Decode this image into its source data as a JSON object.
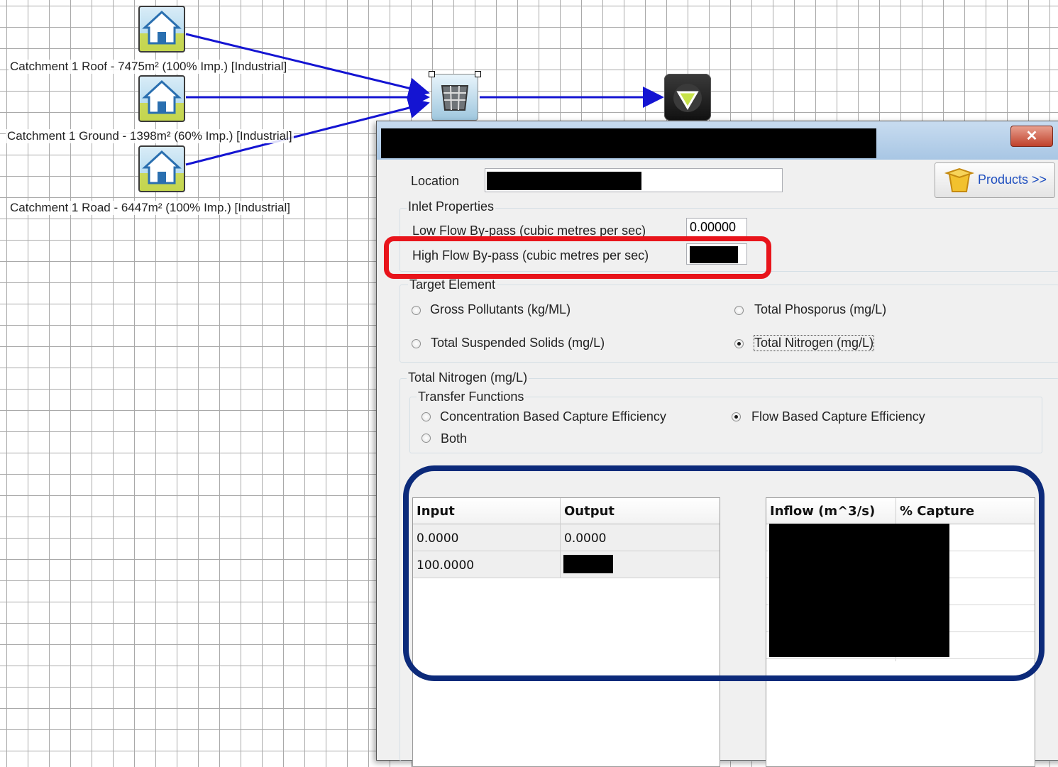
{
  "canvas": {
    "nodes": [
      {
        "label": "Catchment 1 Roof - 7475m² (100% Imp.) [Industrial]"
      },
      {
        "label": "Catchment 1 Ground - 1398m² (60% Imp.) [Industrial]"
      },
      {
        "label": "Catchment 1 Road - 6447m² (100% Imp.) [Industrial]"
      }
    ]
  },
  "dialog": {
    "close_glyph": "✕",
    "location_label": "Location",
    "products_label": "Products >>",
    "inlet": {
      "legend": "Inlet Properties",
      "low_flow_label": "Low Flow By-pass (cubic metres per sec)",
      "low_flow_value": "0.00000",
      "high_flow_label": "High Flow By-pass (cubic metres per sec)"
    },
    "target": {
      "legend": "Target Element",
      "options": [
        "Gross Pollutants (kg/ML)",
        "Total Phosporus (mg/L)",
        "Total Suspended Solids (mg/L)",
        "Total Nitrogen (mg/L)"
      ],
      "selected": "Total Nitrogen (mg/L)"
    },
    "nitrogen": {
      "legend": "Total Nitrogen (mg/L)",
      "transfer_legend": "Transfer Functions",
      "options": [
        "Concentration Based Capture Efficiency",
        "Flow Based Capture Efficiency",
        "Both"
      ],
      "selected": "Flow Based Capture Efficiency"
    },
    "conc_table": {
      "headers": [
        "Input",
        "Output"
      ],
      "rows": [
        [
          "0.0000",
          "0.0000"
        ],
        [
          "100.0000",
          ""
        ]
      ]
    },
    "flow_table": {
      "headers": [
        "Inflow (m^3/s)",
        "% Capture"
      ]
    }
  },
  "colors": {
    "link": "#1414d2",
    "annotation_red": "#e8141b",
    "annotation_blue": "#0c2a7a"
  }
}
